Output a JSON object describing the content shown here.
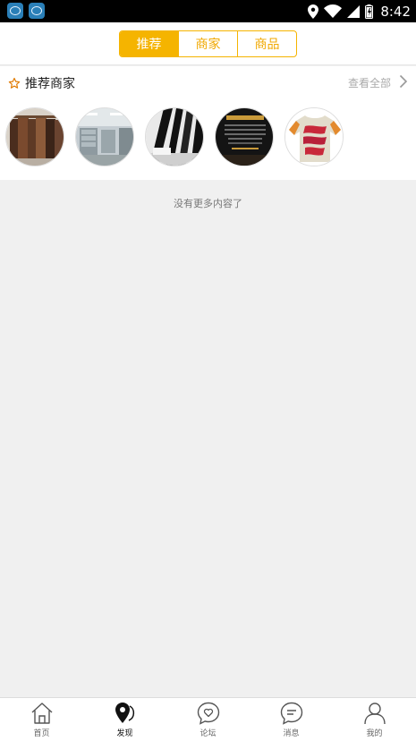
{
  "status_bar": {
    "time": "8:42"
  },
  "tabs": [
    {
      "label": "推荐",
      "active": true
    },
    {
      "label": "商家",
      "active": false
    },
    {
      "label": "商品",
      "active": false
    }
  ],
  "recommended": {
    "title": "推荐商家",
    "view_all": "查看全部"
  },
  "no_more_text": "没有更多内容了",
  "bottom_nav": [
    {
      "label": "首页",
      "icon": "home-icon"
    },
    {
      "label": "发现",
      "icon": "discover-icon",
      "active": true
    },
    {
      "label": "论坛",
      "icon": "forum-icon"
    },
    {
      "label": "消息",
      "icon": "message-icon"
    },
    {
      "label": "我的",
      "icon": "profile-icon"
    }
  ],
  "colors": {
    "accent": "#f5b400",
    "status_bar": "#000000",
    "page_background": "#f0f0f0"
  }
}
